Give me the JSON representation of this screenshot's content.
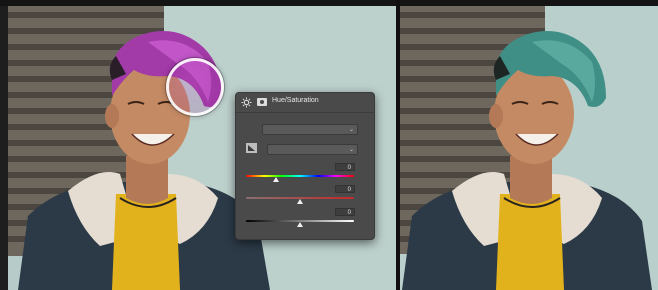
{
  "panel": {
    "title": "Hue/Saturation",
    "preset_value": "",
    "channel_value": "",
    "hue_value": "0",
    "saturation_value": "0",
    "lightness_value": "0",
    "hue_level": 0.28,
    "saturation_level": 0.5,
    "lightness_level": 0.5
  },
  "icons": {
    "adjustment": "adjustment-layer-icon",
    "mask": "mask-icon",
    "hand": "targeted-adjustment-icon",
    "chevron": "chevron-down-icon",
    "loupe": "hue-picker-loupe"
  },
  "colors": {
    "hair_before": "#a23aa8",
    "hair_after": "#3f8f86",
    "panel_bg": "#4a4a4a",
    "shirt": "#e2b21c",
    "wall": "#b9cfcb"
  }
}
